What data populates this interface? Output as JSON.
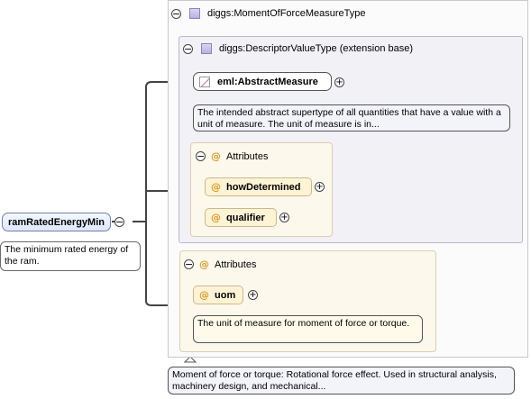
{
  "root_element": {
    "name": "ramRatedEnergyMin",
    "doc": "The minimum rated energy of the ram."
  },
  "type": {
    "title": "diggs:MomentOfForceMeasureType",
    "doc": "Moment of force or torque: Rotational force effect. Used in structural analysis, machinery design, and mechanical..."
  },
  "extension": {
    "title": "diggs:DescriptorValueType (extension base)",
    "abstract_element": "eml:AbstractMeasure",
    "abstract_doc": "The intended abstract supertype of all quantities that have a value with a unit of measure. The unit of measure is in...",
    "attributes_label": "Attributes",
    "attributes": [
      "howDetermined",
      "qualifier"
    ]
  },
  "own_attributes": {
    "label": "Attributes",
    "items": [
      "uom"
    ],
    "uom_doc": "The unit of measure for moment of force or torque."
  },
  "symbols": {
    "collapse": "−",
    "expand": "+",
    "attribute": "@"
  }
}
